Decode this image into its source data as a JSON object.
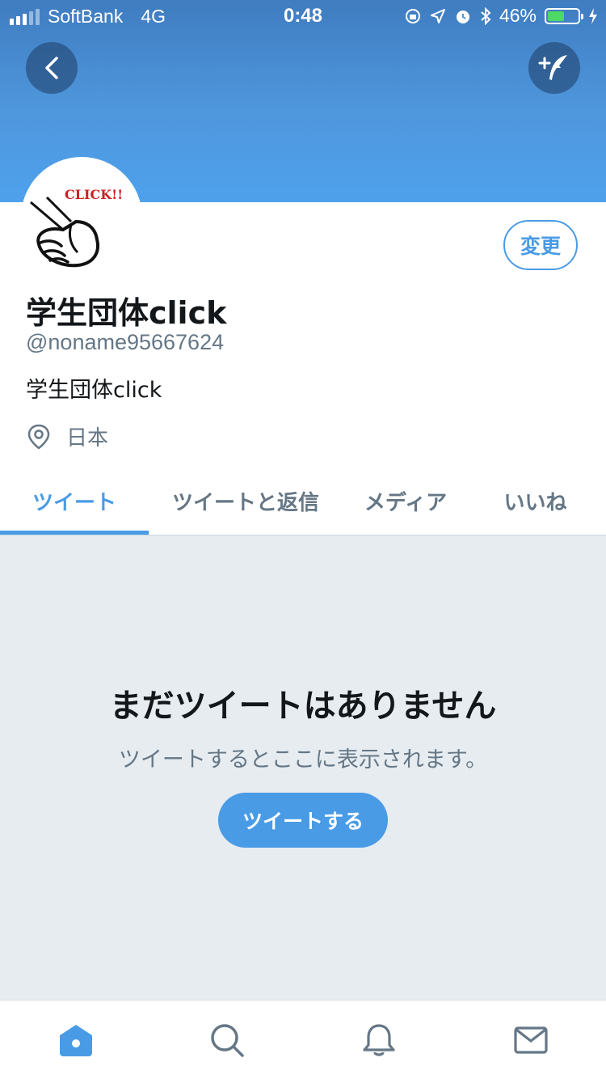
{
  "status_bar": {
    "carrier": "SoftBank",
    "network": "4G",
    "time": "0:48",
    "battery_percent": "46%",
    "battery_level": 0.46
  },
  "profile": {
    "avatar_text": "CLICK!!",
    "display_name": "学生団体click",
    "handle": "@noname95667624",
    "bio": "学生団体click",
    "location": "日本",
    "edit_label": "変更"
  },
  "tabs": [
    {
      "label": "ツイート",
      "active": true
    },
    {
      "label": "ツイートと返信",
      "active": false
    },
    {
      "label": "メディア",
      "active": false
    },
    {
      "label": "いいね",
      "active": false
    }
  ],
  "empty_state": {
    "title": "まだツイートはありません",
    "subtitle": "ツイートするとここに表示されます。",
    "button_label": "ツイートする"
  },
  "bottom_nav": [
    "home-icon",
    "search-icon",
    "notifications-icon",
    "messages-icon"
  ],
  "colors": {
    "accent": "#4a9be6",
    "banner": "#4a94dc",
    "empty_bg": "#e6ecf0"
  }
}
